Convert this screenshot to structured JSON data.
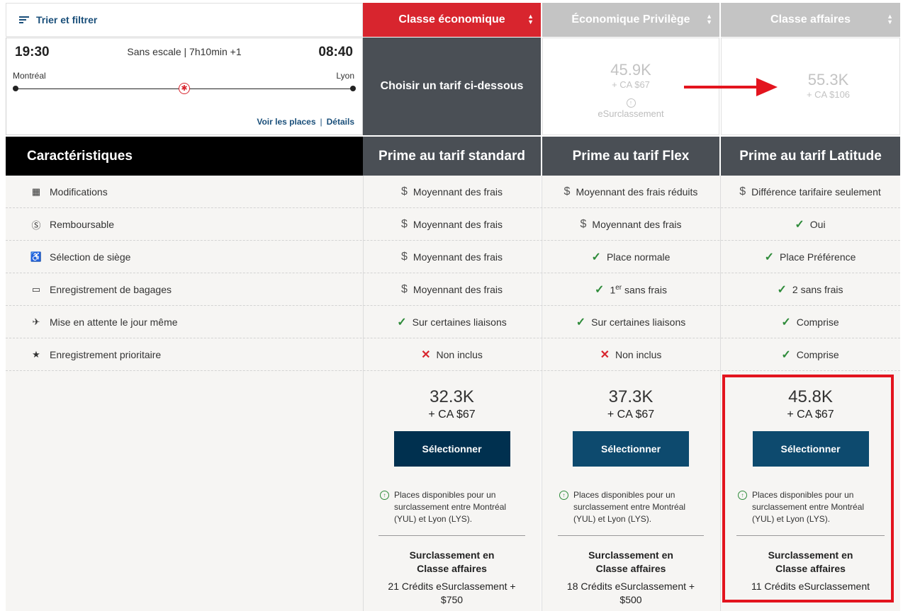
{
  "sort": {
    "label": "Trier et filtrer"
  },
  "cabins": {
    "economy": "Classe économique",
    "premium": "Économique Privilège",
    "business": "Classe affaires",
    "sort_arrows": "▲▼"
  },
  "flight": {
    "depart_time": "19:30",
    "arrive_time": "08:40",
    "summary": "Sans escale | 7h10min +1",
    "origin": "Montréal",
    "destination": "Lyon",
    "seats_link": "Voir les places",
    "sep": "|",
    "details_link": "Détails"
  },
  "choose_fare": "Choisir un tarif ci-dessous",
  "premium_fare": {
    "points": "45.9K",
    "cash": "+ CA $67",
    "label": "eSurclassement"
  },
  "business_fare": {
    "points": "55.3K",
    "cash": "+ CA $106"
  },
  "features_header": "Caractéristiques",
  "fare_headers": {
    "standard": "Prime au tarif standard",
    "flex": "Prime au tarif Flex",
    "latitude": "Prime au tarif Latitude"
  },
  "features": [
    {
      "label": "Modifications",
      "icon": "calendar-icon",
      "std": "Moyennant des frais",
      "std_sym": "dollar",
      "flex": "Moyennant des frais réduits",
      "flex_sym": "dollar",
      "lat": "Différence tarifaire seulement",
      "lat_sym": "dollar"
    },
    {
      "label": "Remboursable",
      "icon": "dollar-circle-icon",
      "std": "Moyennant des frais",
      "std_sym": "dollar",
      "flex": "Moyennant des frais",
      "flex_sym": "dollar",
      "lat": "Oui",
      "lat_sym": "check"
    },
    {
      "label": "Sélection de siège",
      "icon": "seat-icon",
      "std": "Moyennant des frais",
      "std_sym": "dollar",
      "flex": "Place normale",
      "flex_sym": "check",
      "lat": "Place Préférence",
      "lat_sym": "check"
    },
    {
      "label": "Enregistrement de bagages",
      "icon": "suitcase-icon",
      "std": "Moyennant des frais",
      "std_sym": "dollar",
      "flex_sup_num": "1",
      "flex_sup": "er",
      "flex": " sans frais",
      "flex_sym": "check",
      "lat": "2 sans frais",
      "lat_sym": "check"
    },
    {
      "label": "Mise en attente le jour même",
      "icon": "plane-clock-icon",
      "std": "Sur certaines liaisons",
      "std_sym": "check",
      "flex": "Sur certaines liaisons",
      "flex_sym": "check",
      "lat": "Comprise",
      "lat_sym": "check"
    },
    {
      "label": "Enregistrement prioritaire",
      "icon": "star-box-icon",
      "std": "Non inclus",
      "std_sym": "cross",
      "flex": "Non inclus",
      "flex_sym": "cross",
      "lat": "Comprise",
      "lat_sym": "check"
    }
  ],
  "symbols": {
    "dollar": "$",
    "check": "✓",
    "cross": "✕"
  },
  "prices": {
    "standard": {
      "points": "32.3K",
      "cash": "+ CA $67",
      "button": "Sélectionner",
      "avail": "Places disponibles pour un surclassement entre Montréal (YUL) et Lyon (LYS).",
      "upg_title": "Surclassement en Classe affaires",
      "upg_cost": "21 Crédits eSurclassement + $750"
    },
    "flex": {
      "points": "37.3K",
      "cash": "+ CA $67",
      "button": "Sélectionner",
      "avail": "Places disponibles pour un surclassement entre Montréal (YUL) et Lyon (LYS).",
      "upg_title": "Surclassement en Classe affaires",
      "upg_cost": "18 Crédits eSurclassement + $500"
    },
    "latitude": {
      "points": "45.8K",
      "cash": "+ CA $67",
      "button": "Sélectionner",
      "avail": "Places disponibles pour un surclassement entre Montréal (YUL) et Lyon (LYS).",
      "upg_title": "Surclassement en Classe affaires",
      "upg_cost": "11 Crédits eSurclassement"
    }
  },
  "colors": {
    "accent_red": "#d8252e",
    "navy": "#0d4a6e",
    "header_gray": "#4a4f55",
    "check_green": "#2e8b3a",
    "highlight_red": "#e3141e"
  }
}
